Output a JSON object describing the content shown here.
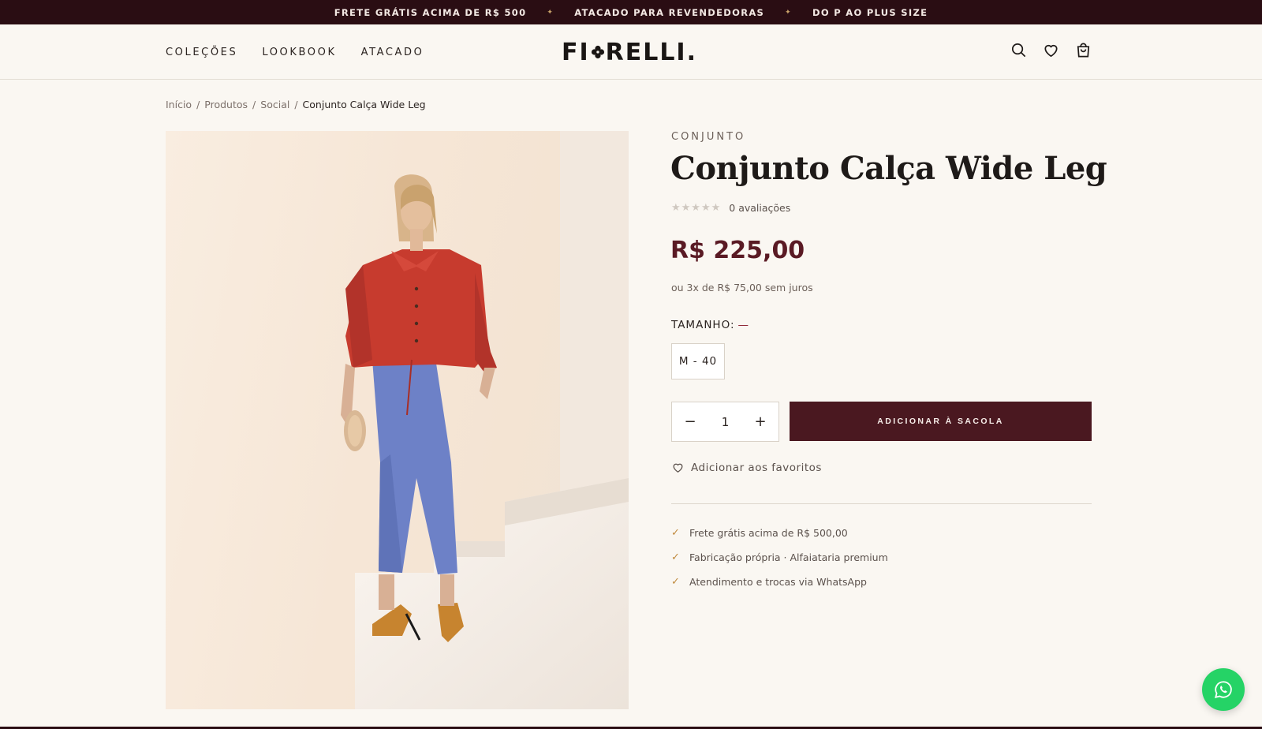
{
  "announcement": {
    "items": [
      "FRETE GRÁTIS ACIMA DE R$ 500",
      "ATACADO PARA REVENDEDORAS",
      "DO P AO PLUS SIZE"
    ],
    "separator": "✦"
  },
  "header": {
    "nav": [
      "COLEÇÕES",
      "LOOKBOOK",
      "ATACADO"
    ],
    "logo": {
      "left": "FI",
      "right": "RELLI."
    },
    "icons": [
      "search-icon",
      "heart-icon",
      "bag-icon"
    ]
  },
  "breadcrumb": {
    "items": [
      "Início",
      "Produtos",
      "Social"
    ],
    "current": "Conjunto Calça Wide Leg",
    "separator": "/"
  },
  "product": {
    "category": "CONJUNTO",
    "title": "Conjunto Calça Wide Leg",
    "stars": "★★★★★",
    "reviews": "0 avaliações",
    "price": "R$ 225,00",
    "installments": "ou 3x de R$ 75,00 sem juros",
    "size_label": "TAMANHO:",
    "size_selected": "—",
    "size_option": "M - 40",
    "quantity": "1",
    "qty_minus": "−",
    "qty_plus": "+",
    "add_to_bag": "ADICIONAR À SACOLA",
    "favorite": "Adicionar aos favoritos",
    "features": [
      "Frete grátis acima de R$ 500,00",
      "Fabricação própria · Alfaiataria premium",
      "Atendimento e trocas via WhatsApp"
    ],
    "check": "✓"
  },
  "colors": {
    "brand": "#4a1820",
    "topbar": "#2a0d13",
    "price": "#5a1a24",
    "accent_check": "#c08a3e",
    "whatsapp": "#25d366",
    "background": "#faf7f2"
  }
}
